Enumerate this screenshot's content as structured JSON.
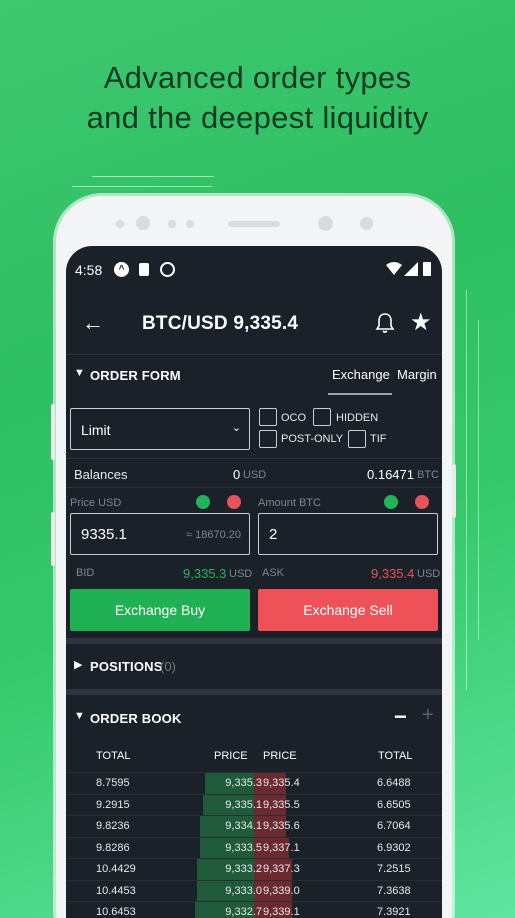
{
  "headline": {
    "line1": "Advanced order types",
    "line2": "and the deepest liquidity"
  },
  "status_bar": {
    "time": "4:58"
  },
  "header": {
    "title": "BTC/USD 9,335.4",
    "back_icon": "back-arrow-icon",
    "bell_icon": "bell-icon",
    "star_icon": "star-icon"
  },
  "order_form": {
    "label": "ORDER FORM",
    "tabs": [
      {
        "label": "Exchange",
        "active": true
      },
      {
        "label": "Margin",
        "active": false
      }
    ],
    "order_type": "Limit",
    "checkboxes": [
      {
        "label": "OCO",
        "checked": false
      },
      {
        "label": "HIDDEN",
        "checked": false
      },
      {
        "label": "POST-ONLY",
        "checked": false
      },
      {
        "label": "TIF",
        "checked": false
      }
    ],
    "balances_label": "Balances",
    "balance_usd_value": "0",
    "balance_usd_unit": "USD",
    "balance_btc_value": "0.16471",
    "balance_btc_unit": "BTC",
    "price_label": "Price USD",
    "amount_label": "Amount BTC",
    "price_value": "9335.1",
    "price_hint": "≈ 18670.20",
    "amount_value": "2",
    "bid_label": "BID",
    "bid_value": "9,335.3",
    "bid_unit": "USD",
    "ask_label": "ASK",
    "ask_value": "9,335.4",
    "ask_unit": "USD",
    "buy_button": "Exchange Buy",
    "sell_button": "Exchange Sell"
  },
  "positions": {
    "label": "POSITIONS",
    "count": "(0)"
  },
  "order_book": {
    "label": "ORDER BOOK",
    "minus": "−",
    "plus": "+",
    "columns": [
      "TOTAL",
      "PRICE",
      "PRICE",
      "TOTAL"
    ],
    "rows": [
      {
        "bid_total": "8.7595",
        "bid_price": "9,335.3",
        "ask_price": "9,335.4",
        "ask_total": "6.6488",
        "bid_depth": 0.18,
        "ask_depth": 0.12
      },
      {
        "bid_total": "9.2915",
        "bid_price": "9,335.1",
        "ask_price": "9,335.5",
        "ask_total": "6.6505",
        "bid_depth": 0.19,
        "ask_depth": 0.12
      },
      {
        "bid_total": "9.8236",
        "bid_price": "9,334.1",
        "ask_price": "9,335.6",
        "ask_total": "6.7064",
        "bid_depth": 0.2,
        "ask_depth": 0.12
      },
      {
        "bid_total": "9.8286",
        "bid_price": "9,333.5",
        "ask_price": "9,337.1",
        "ask_total": "6.9302",
        "bid_depth": 0.2,
        "ask_depth": 0.13
      },
      {
        "bid_total": "10.4429",
        "bid_price": "9,333.2",
        "ask_price": "9,337.3",
        "ask_total": "7.2515",
        "bid_depth": 0.21,
        "ask_depth": 0.14
      },
      {
        "bid_total": "10.4453",
        "bid_price": "9,333.0",
        "ask_price": "9,339.0",
        "ask_total": "7.3638",
        "bid_depth": 0.21,
        "ask_depth": 0.14
      },
      {
        "bid_total": "10.6453",
        "bid_price": "9,332.7",
        "ask_price": "9,339.1",
        "ask_total": "7.3921",
        "bid_depth": 0.22,
        "ask_depth": 0.14
      }
    ]
  },
  "colors": {
    "buy": "#1fb154",
    "sell": "#ee5157",
    "background": "#1b2128"
  }
}
